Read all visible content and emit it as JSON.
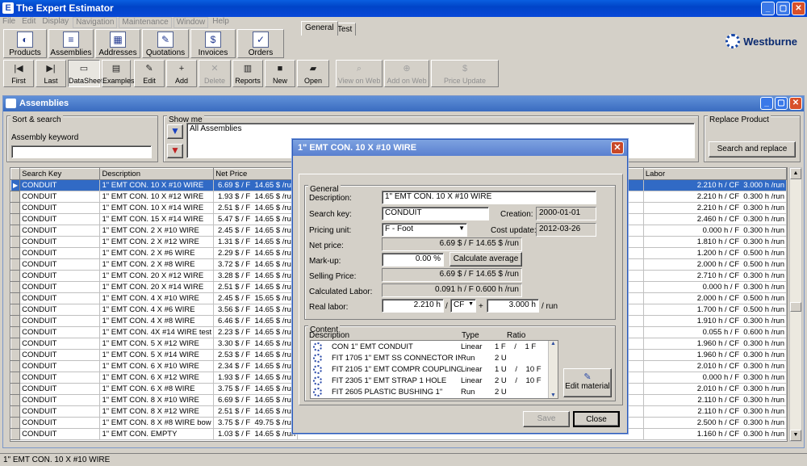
{
  "window": {
    "title": "The Expert Estimator",
    "app_icon": "E",
    "minimize": "_",
    "maximize": "▢",
    "close": "✕"
  },
  "menu": [
    "File",
    "Edit",
    "Display",
    "Navigation",
    "Maintenance",
    "Window",
    "Help"
  ],
  "nav_buttons": [
    {
      "label": "Products",
      "icon": "products-icon",
      "glyph": "◐"
    },
    {
      "label": "Assemblies",
      "icon": "assemblies-icon",
      "glyph": "≡"
    },
    {
      "label": "Addresses",
      "icon": "addresses-icon",
      "glyph": "▦"
    },
    {
      "label": "Quotations",
      "icon": "quotations-icon",
      "glyph": "✎"
    },
    {
      "label": "Invoices",
      "icon": "invoices-icon",
      "glyph": "$"
    },
    {
      "label": "Orders",
      "icon": "orders-icon",
      "glyph": "✓"
    }
  ],
  "brand": "Westburne",
  "toolbar": [
    {
      "label": "First",
      "glyph": "|◀",
      "state": "normal"
    },
    {
      "label": "Last",
      "glyph": "▶|",
      "state": "normal"
    },
    {
      "label": "DataSheet",
      "glyph": "▭",
      "state": "pressed"
    },
    {
      "label": "Examples",
      "glyph": "▤",
      "state": "normal"
    },
    {
      "label": "Edit",
      "glyph": "✎",
      "state": "normal"
    },
    {
      "label": "Add",
      "glyph": "+",
      "state": "normal"
    },
    {
      "label": "Delete",
      "glyph": "✕",
      "state": "disabled"
    },
    {
      "label": "Reports",
      "glyph": "▥",
      "state": "normal"
    },
    {
      "label": "New",
      "glyph": "■",
      "state": "normal"
    },
    {
      "label": "Open",
      "glyph": "▰",
      "state": "normal"
    },
    {
      "label": "View on Web",
      "glyph": "⌕",
      "state": "disabled"
    },
    {
      "label": "Add on Web",
      "glyph": "⊕",
      "state": "disabled"
    },
    {
      "label": "Price Update",
      "glyph": "$",
      "state": "disabled"
    }
  ],
  "assemblies": {
    "title": "Assemblies",
    "sort_search": {
      "title": "Sort & search",
      "keyword_label": "Assembly keyword",
      "keyword_value": ""
    },
    "show_me": {
      "title": "Show me",
      "value": "All Assemblies"
    },
    "replace": {
      "title": "Replace Product",
      "button": "Search and replace"
    },
    "columns": [
      "Search Key",
      "Description",
      "Net Price",
      "Ma",
      "Labor"
    ],
    "rows": [
      {
        "key": "CONDUIT",
        "desc": "1\" EMT CON. 10 X #10 WIRE",
        "net": "6.69 $ / F",
        "run": "14.65 $ /run",
        "labor": "2.210 h / CF",
        "labor2": "3.000 h /run",
        "selected": true
      },
      {
        "key": "CONDUIT",
        "desc": "1\" EMT CON. 10 X #12 WIRE",
        "net": "1.93 $ / F",
        "run": "14.65 $ /run",
        "labor": "2.210 h / CF",
        "labor2": "0.300 h /run"
      },
      {
        "key": "CONDUIT",
        "desc": "1\" EMT CON. 10 X #14 WIRE",
        "net": "2.51 $ / F",
        "run": "14.65 $ /run",
        "labor": "2.210 h / CF",
        "labor2": "0.300 h /run"
      },
      {
        "key": "CONDUIT",
        "desc": "1\" EMT CON. 15 X #14 WIRE",
        "net": "5.47 $ / F",
        "run": "14.65 $ /run",
        "labor": "2.460 h / CF",
        "labor2": "0.300 h /run"
      },
      {
        "key": "CONDUIT",
        "desc": "1\" EMT CON. 2 X #10 WIRE",
        "net": "2.45 $ / F",
        "run": "14.65 $ /run",
        "labor": "0.000 h / F",
        "labor2": "0.300 h /run"
      },
      {
        "key": "CONDUIT",
        "desc": "1\" EMT CON. 2 X #12 WIRE",
        "net": "1.31 $ / F",
        "run": "14.65 $ /run",
        "labor": "1.810 h / CF",
        "labor2": "0.300 h /run"
      },
      {
        "key": "CONDUIT",
        "desc": "1\" EMT CON. 2 X #6 WIRE",
        "net": "2.29 $ / F",
        "run": "14.65 $ /run",
        "labor": "1.200 h / CF",
        "labor2": "0.500 h /run"
      },
      {
        "key": "CONDUIT",
        "desc": "1\" EMT CON. 2 X #8 WIRE",
        "net": "3.72 $ / F",
        "run": "14.65 $ /run",
        "labor": "2.000 h / CF",
        "labor2": "0.500 h /run"
      },
      {
        "key": "CONDUIT",
        "desc": "1\" EMT CON. 20 X #12 WIRE",
        "net": "3.28 $ / F",
        "run": "14.65 $ /run",
        "labor": "2.710 h / CF",
        "labor2": "0.300 h /run"
      },
      {
        "key": "CONDUIT",
        "desc": "1\" EMT CON. 20 X #14 WIRE",
        "net": "2.51 $ / F",
        "run": "14.65 $ /run",
        "labor": "0.000 h / F",
        "labor2": "0.300 h /run"
      },
      {
        "key": "CONDUIT",
        "desc": "1\" EMT CON. 4 X #10 WIRE",
        "net": "2.45 $ / F",
        "run": "15.65 $ /run",
        "labor": "2.000 h / CF",
        "labor2": "0.500 h /run"
      },
      {
        "key": "CONDUIT",
        "desc": "1\" EMT CON. 4 X #6 WIRE",
        "net": "3.56 $ / F",
        "run": "14.65 $ /run",
        "labor": "1.700 h / CF",
        "labor2": "0.500 h /run"
      },
      {
        "key": "CONDUIT",
        "desc": "1\" EMT CON. 4 X #8 WIRE",
        "net": "6.46 $ / F",
        "run": "14.65 $ /run",
        "labor": "1.910 h / CF",
        "labor2": "0.300 h /run"
      },
      {
        "key": "CONDUIT",
        "desc": "1\" EMT CON. 4X #14 WIRE test",
        "net": "2.23 $ / F",
        "run": "14.65 $ /run",
        "labor": "0.055 h / F",
        "labor2": "0.600 h /run"
      },
      {
        "key": "CONDUIT",
        "desc": "1\" EMT CON. 5 X #12 WIRE",
        "net": "3.30 $ / F",
        "run": "14.65 $ /run",
        "labor": "1.960 h / CF",
        "labor2": "0.300 h /run"
      },
      {
        "key": "CONDUIT",
        "desc": "1\" EMT CON. 5 X #14 WIRE",
        "net": "2.53 $ / F",
        "run": "14.65 $ /run",
        "labor": "1.960 h / CF",
        "labor2": "0.300 h /run"
      },
      {
        "key": "CONDUIT",
        "desc": "1\" EMT CON. 6 X #10 WIRE",
        "net": "2.34 $ / F",
        "run": "14.65 $ /run",
        "labor": "2.010 h / CF",
        "labor2": "0.300 h /run"
      },
      {
        "key": "CONDUIT",
        "desc": "1\" EMT CON. 6 X #12 WIRE",
        "net": "1.93 $ / F",
        "run": "14.65 $ /run",
        "labor": "0.000 h / F",
        "labor2": "0.300 h /run"
      },
      {
        "key": "CONDUIT",
        "desc": "1\" EMT CON. 6 X #8 WIRE",
        "net": "3.75 $ / F",
        "run": "14.65 $ /run",
        "labor": "2.010 h / CF",
        "labor2": "0.300 h /run"
      },
      {
        "key": "CONDUIT",
        "desc": "1\" EMT CON. 8 X #10 WIRE",
        "net": "6.69 $ / F",
        "run": "14.65 $ /run",
        "labor": "2.110 h / CF",
        "labor2": "0.300 h /run"
      },
      {
        "key": "CONDUIT",
        "desc": "1\" EMT CON. 8 X #12 WIRE",
        "net": "2.51 $ / F",
        "run": "14.65 $ /run",
        "labor": "2.110 h / CF",
        "labor2": "0.300 h /run"
      },
      {
        "key": "CONDUIT",
        "desc": "1\" EMT CON. 8 X #8 WIRE bow",
        "net": "3.75 $ / F",
        "run": "49.75 $ /run",
        "labor": "2.500 h / CF",
        "labor2": "0.300 h /run"
      },
      {
        "key": "CONDUIT",
        "desc": "1\" EMT CON. EMPTY",
        "net": "1.03 $ / F",
        "run": "14.65 $ /run",
        "labor": "1.160 h / CF",
        "labor2": "0.300 h /run"
      }
    ]
  },
  "dialog": {
    "title": "1\" EMT CON. 10 X #10 WIRE",
    "tabs": [
      "General",
      "Test"
    ],
    "general_title": "General",
    "description_label": "Description:",
    "description": "1\" EMT CON. 10 X #10 WIRE",
    "search_key_label": "Search key:",
    "search_key": "CONDUIT",
    "creation_label": "Creation:",
    "creation": "2000-01-01",
    "pricing_unit_label": "Pricing unit:",
    "pricing_unit": "F  - Foot",
    "cost_update_label": "Cost update:",
    "cost_update": "2012-03-26",
    "net_price_label": "Net price:",
    "net_price": "6.69 $ / F  14.65 $ /run",
    "markup_label": "Mark-up:",
    "markup": "0.00 %",
    "calc_average": "Calculate average",
    "selling_price_label": "Selling Price:",
    "selling_price": "6.69 $ / F  14.65 $ /run",
    "calc_labor_label": "Calculated Labor:",
    "calc_labor": "0.091 h / F  0.600 h /run",
    "real_labor_label": "Real labor:",
    "real_labor_h": "2.210 h",
    "slash": "/",
    "real_labor_unit": "CF",
    "plus": "+",
    "real_labor_run": "3.000 h",
    "per_run": "/ run",
    "content_title": "Content",
    "content_cols": [
      "Description",
      "Type",
      "Ratio"
    ],
    "content": [
      {
        "desc": "CON 1\" EMT CONDUIT",
        "type": "Linear",
        "ratio": "1 F    /    1 F"
      },
      {
        "desc": "FIT 1705 1\" EMT SS CONNECTOR IN TH",
        "type": "Run",
        "ratio": "2 U"
      },
      {
        "desc": "FIT 2105 1\" EMT COMPR COUPLING R/",
        "type": "Linear",
        "ratio": "1 U    /    10 F"
      },
      {
        "desc": "FIT 2305 1\" EMT STRAP 1 HOLE",
        "type": "Linear",
        "ratio": "2 U    /    10 F"
      },
      {
        "desc": "FIT 2605 PLASTIC BUSHING 1\"",
        "type": "Run",
        "ratio": "2 U"
      }
    ],
    "edit_material": "Edit material",
    "save": "Save",
    "close": "Close"
  },
  "status": "1\" EMT CON. 10 X #10 WIRE"
}
